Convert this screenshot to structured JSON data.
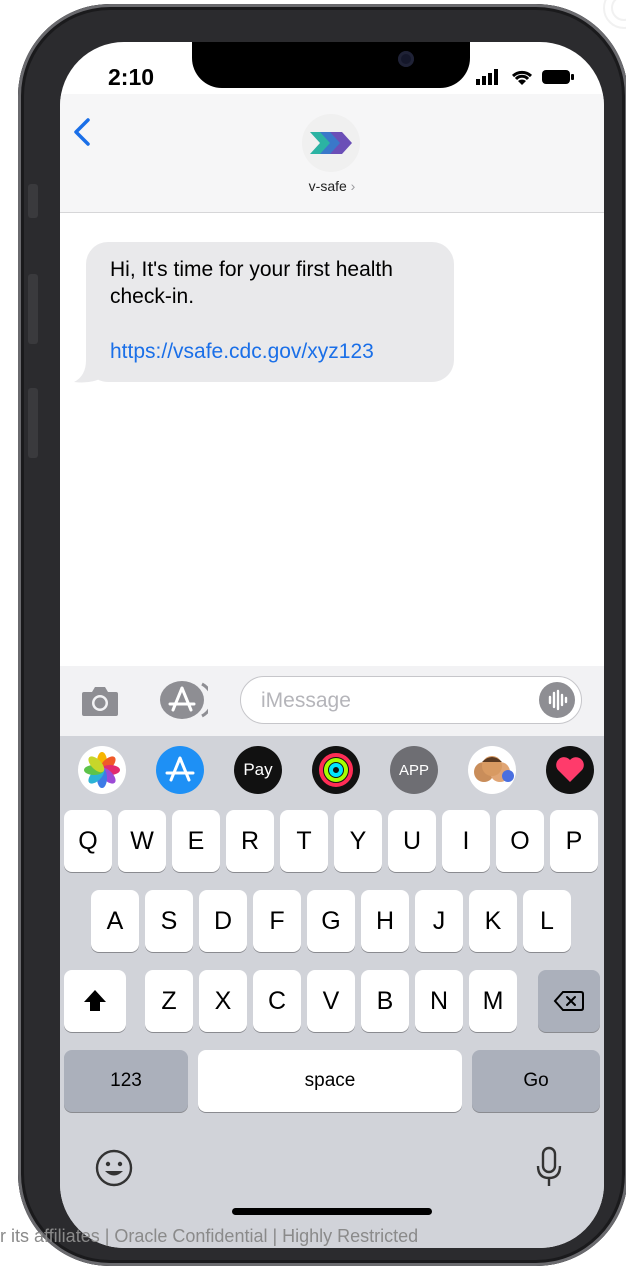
{
  "status": {
    "time": "2:10"
  },
  "header": {
    "contact_name": "v-safe",
    "chevron": "›"
  },
  "message": {
    "text": "Hi, It's time for your first health check-in.",
    "link": "https://vsafe.cdc.gov/xyz123"
  },
  "input": {
    "placeholder": "iMessage"
  },
  "app_strip": [
    {
      "name": "photos-icon",
      "label": ""
    },
    {
      "name": "app-store-icon",
      "label": ""
    },
    {
      "name": "apple-pay-icon",
      "label": "Pay"
    },
    {
      "name": "activity-icon",
      "label": ""
    },
    {
      "name": "app-icon",
      "label": "APP"
    },
    {
      "name": "memoji-icon",
      "label": ""
    },
    {
      "name": "digital-touch-icon",
      "label": ""
    }
  ],
  "keyboard": {
    "row1": [
      "Q",
      "W",
      "E",
      "R",
      "T",
      "Y",
      "U",
      "I",
      "O",
      "P"
    ],
    "row2": [
      "A",
      "S",
      "D",
      "F",
      "G",
      "H",
      "J",
      "K",
      "L"
    ],
    "row3": [
      "Z",
      "X",
      "C",
      "V",
      "B",
      "N",
      "M"
    ],
    "numbers_label": "123",
    "space_label": "space",
    "go_label": "Go"
  },
  "footer": {
    "text": "r its affiliates | Oracle Confidential | Highly Restricted"
  },
  "colors": {
    "link": "#1a6fe8",
    "bubble": "#e9e9eb",
    "keyboard_bg": "#d1d3d9"
  }
}
